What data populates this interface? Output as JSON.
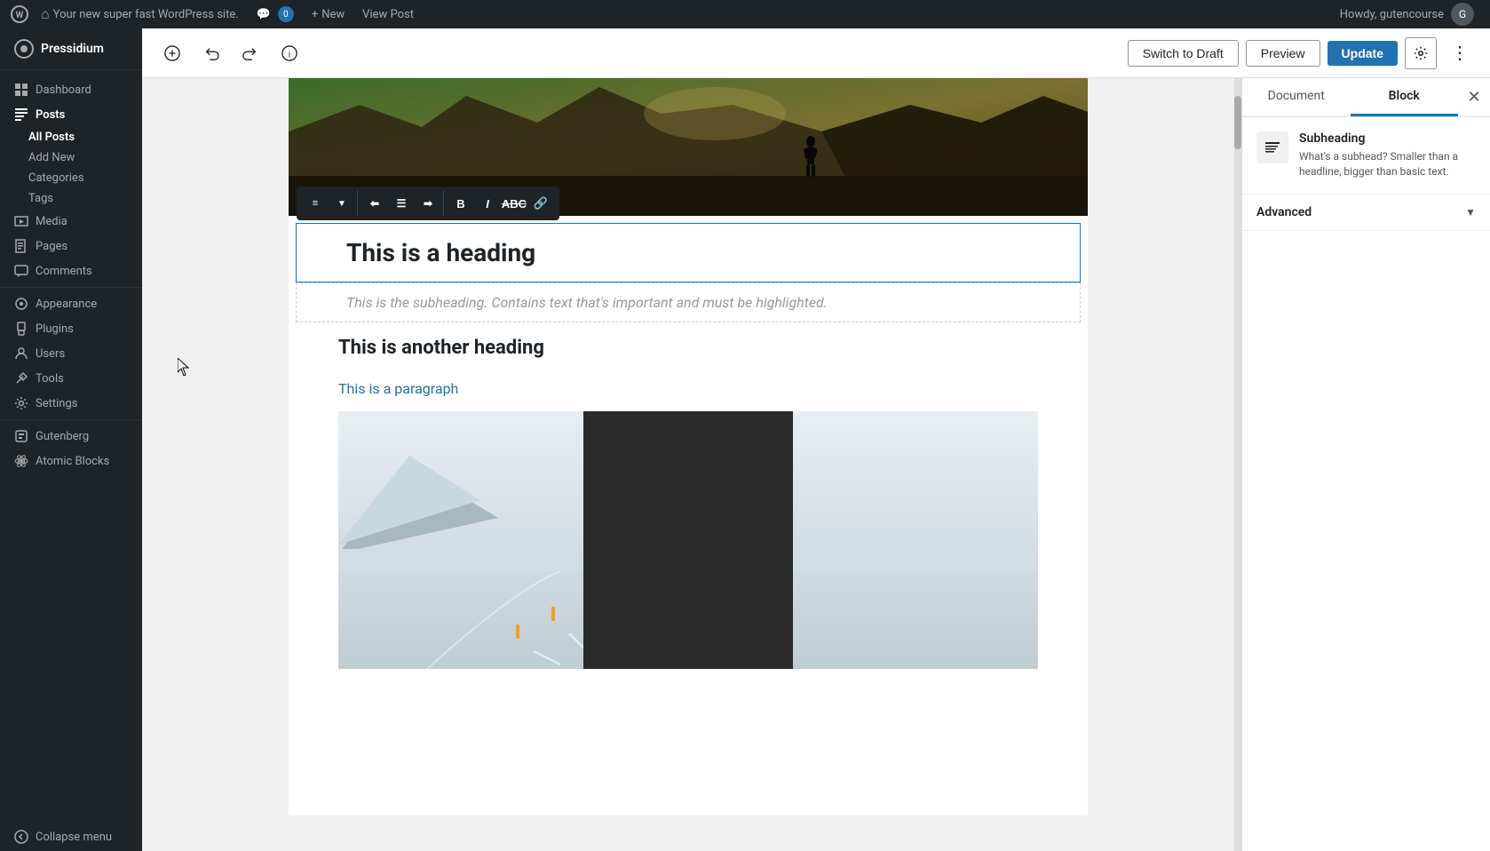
{
  "adminBar": {
    "logo": "wordpress-logo",
    "siteLabel": "Your new super fast WordPress site.",
    "commentCount": "0",
    "newLabel": "New",
    "viewPostLabel": "View Post",
    "userGreeting": "Howdy, gutencourse"
  },
  "sidebar": {
    "brandName": "Pressidium",
    "items": [
      {
        "id": "dashboard",
        "label": "Dashboard",
        "icon": "dashboard-icon"
      },
      {
        "id": "posts",
        "label": "Posts",
        "icon": "posts-icon",
        "active": true
      },
      {
        "id": "media",
        "label": "Media",
        "icon": "media-icon"
      },
      {
        "id": "pages",
        "label": "Pages",
        "icon": "pages-icon"
      },
      {
        "id": "comments",
        "label": "Comments",
        "icon": "comments-icon"
      },
      {
        "id": "appearance",
        "label": "Appearance",
        "icon": "appearance-icon"
      },
      {
        "id": "plugins",
        "label": "Plugins",
        "icon": "plugins-icon"
      },
      {
        "id": "users",
        "label": "Users",
        "icon": "users-icon"
      },
      {
        "id": "tools",
        "label": "Tools",
        "icon": "tools-icon"
      },
      {
        "id": "settings",
        "label": "Settings",
        "icon": "settings-icon"
      },
      {
        "id": "gutenberg",
        "label": "Gutenberg",
        "icon": "gutenberg-icon"
      },
      {
        "id": "atomic-blocks",
        "label": "Atomic Blocks",
        "icon": "atomic-blocks-icon"
      }
    ],
    "subItems": {
      "posts": [
        {
          "id": "all-posts",
          "label": "All Posts",
          "active": true
        },
        {
          "id": "add-new",
          "label": "Add New"
        },
        {
          "id": "categories",
          "label": "Categories"
        },
        {
          "id": "tags",
          "label": "Tags"
        }
      ]
    },
    "collapseLabel": "Collapse menu"
  },
  "toolbar": {
    "addBlockLabel": "+",
    "undoLabel": "undo",
    "redoLabel": "redo",
    "infoLabel": "i",
    "switchDraftLabel": "Switch to Draft",
    "previewLabel": "Preview",
    "updateLabel": "Update",
    "settingsLabel": "settings",
    "moreLabel": "⋮"
  },
  "editor": {
    "headingText": "This is a heading",
    "subheadingPlaceholder": "This is the subheading. Contains text that's important and must be highlighted.",
    "heading2Text": "This is another heading",
    "paragraphText": "This is a paragraph"
  },
  "rightPanel": {
    "tabs": [
      {
        "id": "document",
        "label": "Document",
        "active": false
      },
      {
        "id": "block",
        "label": "Block",
        "active": true
      }
    ],
    "block": {
      "title": "Subheading",
      "description": "What's a subhead? Smaller than a headline, bigger than basic text."
    },
    "sections": [
      {
        "id": "advanced",
        "label": "Advanced",
        "collapsed": false
      }
    ]
  }
}
